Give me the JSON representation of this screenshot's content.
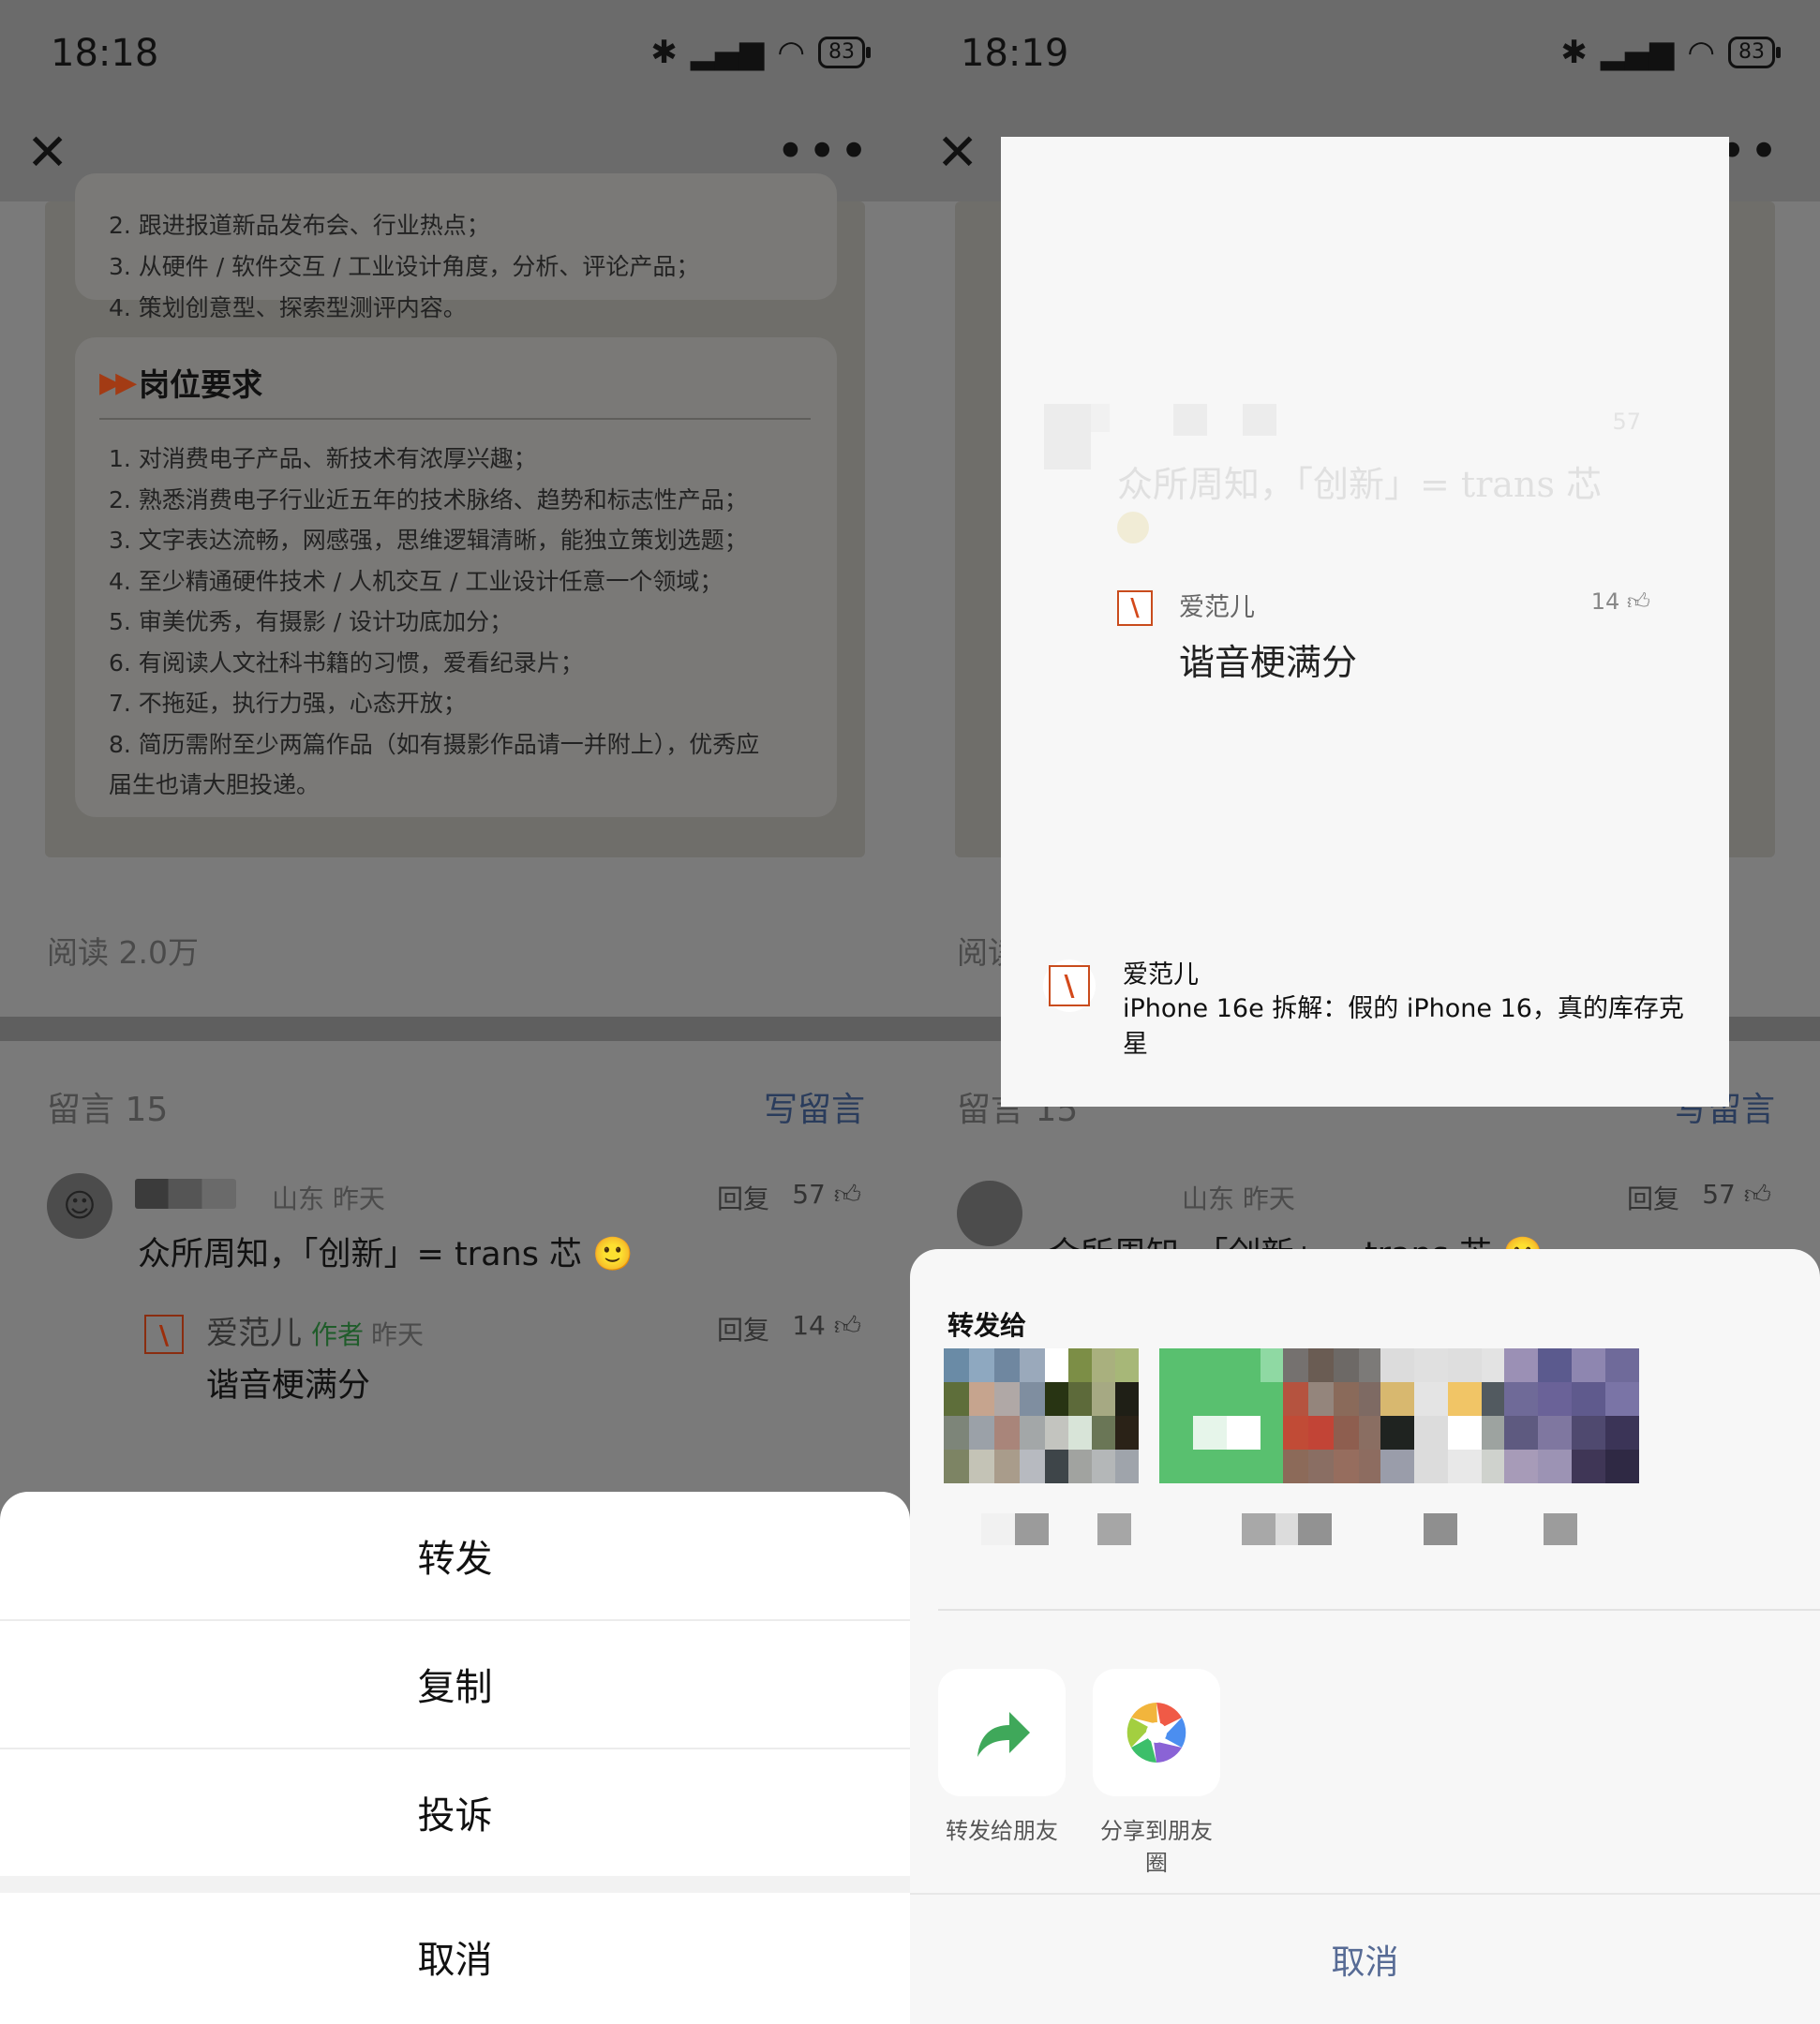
{
  "left": {
    "status": {
      "time": "18:18",
      "battery": "83"
    },
    "article": {
      "card1_items": [
        "2. 跟进报道新品发布会、行业热点；",
        "3. 从硬件 / 软件交互 / 工业设计角度，分析、评论产品；",
        "4. 策划创意型、探索型测评内容。"
      ],
      "requirements_title": "岗位要求",
      "requirements": [
        "1. 对消费电子产品、新技术有浓厚兴趣；",
        "2. 熟悉消费电子行业近五年的技术脉络、趋势和标志性产品；",
        "3. 文字表达流畅，网感强，思维逻辑清晰，能独立策划选题；",
        "4. 至少精通硬件技术 / 人机交互 / 工业设计任意一个领域；",
        "5. 审美优秀，有摄影 / 设计功底加分；",
        "6. 有阅读人文社科书籍的习惯，爱看纪录片；",
        "7. 不拖延，执行力强，心态开放；",
        "8. 简历需附至少两篇作品（如有摄影作品请一并附上），优秀应",
        "   届生也请大胆投递。"
      ],
      "read_count": "阅读 2.0万"
    },
    "comments": {
      "title": "留言 15",
      "write": "写留言",
      "main": {
        "meta": "山东 昨天",
        "reply": "回复",
        "likes": "57",
        "text": "众所周知，「创新」= trans 芯 🙂"
      },
      "sub": {
        "name": "爱范儿",
        "tag": "作者",
        "time": "昨天",
        "reply": "回复",
        "likes": "14",
        "text": "谐音梗满分"
      }
    },
    "sheet": {
      "forward": "转发",
      "copy": "复制",
      "report": "投诉",
      "cancel": "取消"
    }
  },
  "right": {
    "status": {
      "time": "18:19",
      "battery": "83"
    },
    "bg": {
      "read_partial": "阅读",
      "comments_partial": "留言 15",
      "write_partial": "写留言",
      "meta": "山东 昨天",
      "reply": "回复",
      "likes": "57",
      "text_partial": "众所周知，「创新」= trans 芯 🙂"
    },
    "preview": {
      "faded_likes": "57",
      "faded_text": "众所周知，「创新」= trans 芯",
      "reply_name": "爱范儿",
      "reply_likes": "14",
      "reply_text": "谐音梗满分",
      "source_name": "爱范儿",
      "source_title": "iPhone 16e 拆解：假的 iPhone 16，真的库存克星"
    },
    "share": {
      "title": "转发给",
      "contact_colors": [
        [
          "#6a8ba6",
          "#8ea8c0",
          "#6f87a0",
          "#9aa9bb",
          "#5e6e3a",
          "#c6a48e",
          "#b0a8a6",
          "#7f8ea0",
          "#7d8579",
          "#9ba1a8",
          "#a9857a",
          "#a3a7a8",
          "#7d8464",
          "#c4c3b6",
          "#a99c8b",
          "#b7bac0"
        ],
        [
          "#ffffff",
          "#7c8e46",
          "#a9b07e",
          "#a7b778",
          "#283413",
          "#5d6a3a",
          "#a6a983",
          "#1f1f16",
          "#c3c4bf",
          "#d8e4d8",
          "#6a7656",
          "#2a2217",
          "#3e4549",
          "#a1a3a0",
          "#b4b7b8",
          "#9fa4ab"
        ],
        [
          "#59c06f",
          "#59c06f",
          "#59c06f",
          "#8fd9a3",
          "#59c06f",
          "#59c06f",
          "#59c06f",
          "#59c06f",
          "#59c06f",
          "#e6f5ea",
          "#ffffff",
          "#59c06f",
          "#59c06f",
          "#59c06f",
          "#59c06f",
          "#59c06f"
        ],
        [
          "#75716f",
          "#6a5c53",
          "#6d6966",
          "#7c7a78",
          "#b5533f",
          "#94857c",
          "#8a6a5a",
          "#7e6a63",
          "#c14b36",
          "#c24436",
          "#8e5e4f",
          "#8a6e62",
          "#8c6a59",
          "#8a6e63",
          "#966d5e",
          "#8d6c60"
        ],
        [
          "#dcdcdc",
          "#e0e0e0",
          "#dedede",
          "#e3e3e3",
          "#d8b86f",
          "#e4e4e4",
          "#f1c566",
          "#525a60",
          "#1f2320",
          "#dcdcdc",
          "#ffffff",
          "#9da3a0",
          "#9a9daa",
          "#dcdcdc",
          "#e8e8e8",
          "#cfd2cd"
        ],
        [
          "#9b90b5",
          "#5b5a8e",
          "#8e86b0",
          "#6f6a9a",
          "#6f6a98",
          "#6a6298",
          "#5f5a8d",
          "#7a74a6",
          "#5e5a80",
          "#7f77a0",
          "#4f496f",
          "#3b3457",
          "#a79bb8",
          "#9c93b4",
          "#3f3656",
          "#2f2944"
        ]
      ],
      "contact_name_colors": [
        [
          "#f1f1f1",
          "#9b9b9b"
        ],
        [
          "#a6a6a6"
        ],
        [
          "#a8a8a8",
          "#dcdcdc"
        ],
        [
          "#929292"
        ],
        [
          "#8f8f8f"
        ],
        [
          "#9c9c9c"
        ]
      ],
      "apps": [
        {
          "label": "转发给朋友"
        },
        {
          "label": "分享到朋友圈"
        }
      ],
      "cancel": "取消"
    }
  }
}
